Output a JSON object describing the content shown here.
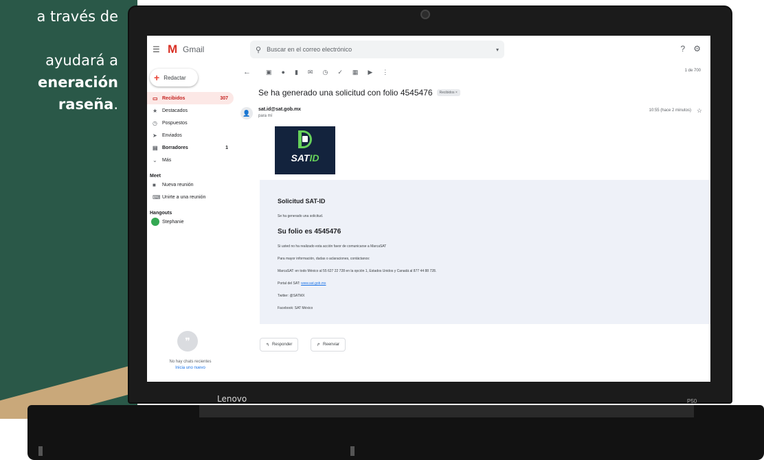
{
  "slide": {
    "line1": "a través de",
    "line2": "ayudará a",
    "line3": "eneración",
    "line4": "raseña",
    "line4_suffix": "."
  },
  "laptop": {
    "brand": "Lenovo",
    "model": "P50"
  },
  "gmail": {
    "app_name": "Gmail",
    "search_placeholder": "Buscar en el correo electrónico",
    "compose_label": "Redactar",
    "nav": [
      {
        "label": "Recibidos",
        "count": "307",
        "icon": "inbox-icon"
      },
      {
        "label": "Destacados",
        "count": "",
        "icon": "star-icon"
      },
      {
        "label": "Pospuestos",
        "count": "",
        "icon": "clock-icon"
      },
      {
        "label": "Enviados",
        "count": "",
        "icon": "send-icon"
      },
      {
        "label": "Borradores",
        "count": "1",
        "icon": "draft-icon"
      },
      {
        "label": "Más",
        "count": "",
        "icon": "chevron-down-icon"
      }
    ],
    "meet_title": "Meet",
    "meet_items": [
      {
        "label": "Nueva reunión",
        "icon": "video-icon"
      },
      {
        "label": "Unirte a una reunión",
        "icon": "keyboard-icon"
      }
    ],
    "hangouts_title": "Hangouts",
    "hangouts_user": "Stephanie",
    "no_chats": "No hay chats recientes",
    "start_new": "Inicia uno nuevo",
    "pager": "1 de 700",
    "subject": "Se ha generado una solicitud con folio 4545476",
    "label_chip": "Recibidos ×",
    "sender": "sat.id@sat.gob.mx",
    "to_me": "para mí",
    "time": "10:55 (hace 2 minutos)",
    "email": {
      "logo_text_sat": "SAT",
      "logo_text_id": "ID",
      "title": "Solicitud SAT-ID",
      "line_generated": "Se ha generado una solicitud.",
      "folio": "Su folio es 4545476",
      "line_not_done": "Si usted no ha realizado esta acción favor de comunicarse a MarcaSAT",
      "line_info": "Para mayor información, dudas o aclaraciones, contáctanos:",
      "line_phone": "MarcaSAT: en todo México al 55 627 22 728 en la opción 1, Estados Unidos y Canadá al 877 44 88 728.",
      "portal_label": "Portal del SAT:",
      "portal_link": "www.sat.gob.mx",
      "twitter": "Twitter: @SATMX",
      "facebook": "Facebook: SAT México"
    },
    "reply_label": "Responder",
    "forward_label": "Reenviar"
  }
}
